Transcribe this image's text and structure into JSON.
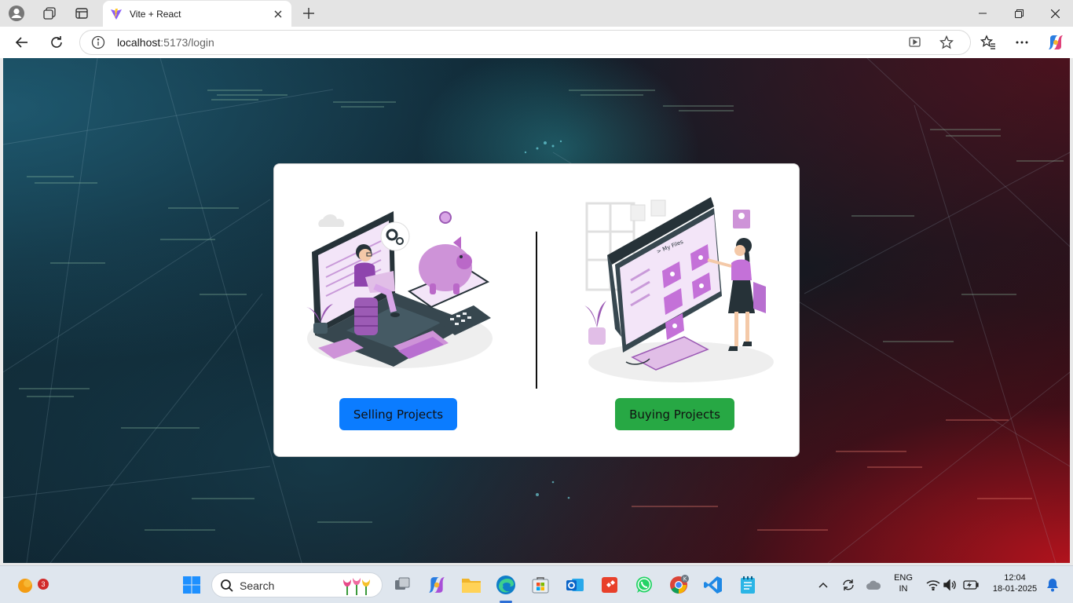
{
  "browser": {
    "tab_title": "Vite + React",
    "url_host": "localhost",
    "url_rest": ":5173/login"
  },
  "page": {
    "sell_button": "Selling Projects",
    "buy_button": "Buying Projects",
    "illustration_files_label": "> My Files"
  },
  "colors": {
    "sell_button": "#0b7cff",
    "buy_button": "#27a844",
    "illustration_accent": "#b86fd0"
  },
  "taskbar": {
    "search_placeholder": "Search",
    "notification_count": "3",
    "language_line1": "ENG",
    "language_line2": "IN",
    "time": "12:04",
    "date": "18-01-2025"
  }
}
